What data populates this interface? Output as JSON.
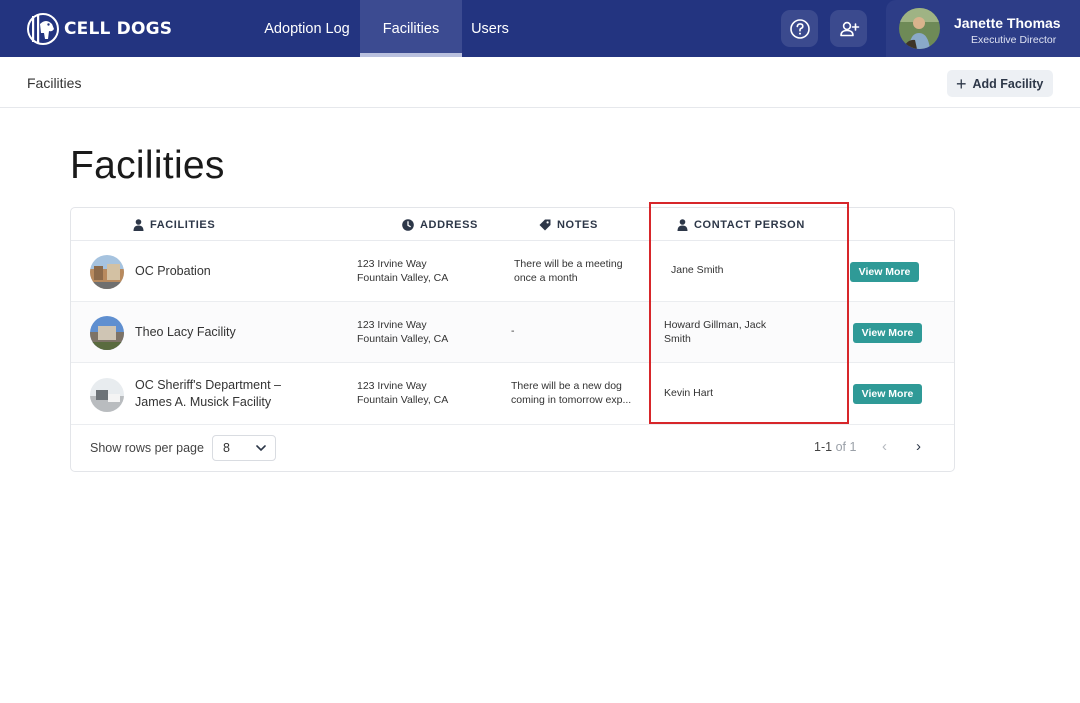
{
  "brand": {
    "name": "CELL DOGS"
  },
  "nav": {
    "tabs": [
      {
        "label": "Adoption Log",
        "active": false
      },
      {
        "label": "Facilities",
        "active": true
      },
      {
        "label": "Users",
        "active": false
      }
    ],
    "icons": [
      "help-icon",
      "add-user-icon"
    ]
  },
  "user": {
    "name": "Janette Thomas",
    "role": "Executive Director"
  },
  "subheader": {
    "breadcrumb": "Facilities",
    "add_button_label": "Add Facility"
  },
  "page": {
    "title": "Facilities"
  },
  "table": {
    "columns": [
      {
        "label": "FACILITIES",
        "icon": "person-icon"
      },
      {
        "label": "ADDRESS",
        "icon": "clock-icon"
      },
      {
        "label": "NOTES",
        "icon": "tag-icon"
      },
      {
        "label": "CONTACT PERSON",
        "icon": "person-icon"
      }
    ],
    "rows": [
      {
        "name": "OC Probation",
        "address_line1": "123 Irvine Way",
        "address_line2": "Fountain Valley, CA",
        "notes": "There will be a meeting once a month",
        "contact": "Jane Smith",
        "action": "View More"
      },
      {
        "name": "Theo Lacy Facility",
        "address_line1": "123 Irvine Way",
        "address_line2": "Fountain Valley, CA",
        "notes": "-",
        "contact": "Howard Gillman, Jack Smith",
        "action": "View More"
      },
      {
        "name_line1": "OC Sheriff's Department –",
        "name_line2": "James A. Musick Facility",
        "address_line1": "123 Irvine Way",
        "address_line2": "Fountain Valley, CA",
        "notes": "There will be a new dog coming in tomorrow exp...",
        "contact": "Kevin Hart",
        "action": "View More"
      }
    ],
    "footer": {
      "rows_per_page_label": "Show rows per page",
      "rows_per_page_value": "8",
      "range": "1-1",
      "of_label": "of 1",
      "prev_icon": "chevron-left-icon",
      "next_icon": "chevron-right-icon"
    }
  },
  "colors": {
    "nav_bg": "#233480",
    "accent_button": "#2f9a97",
    "highlight_border": "#d7262a"
  }
}
